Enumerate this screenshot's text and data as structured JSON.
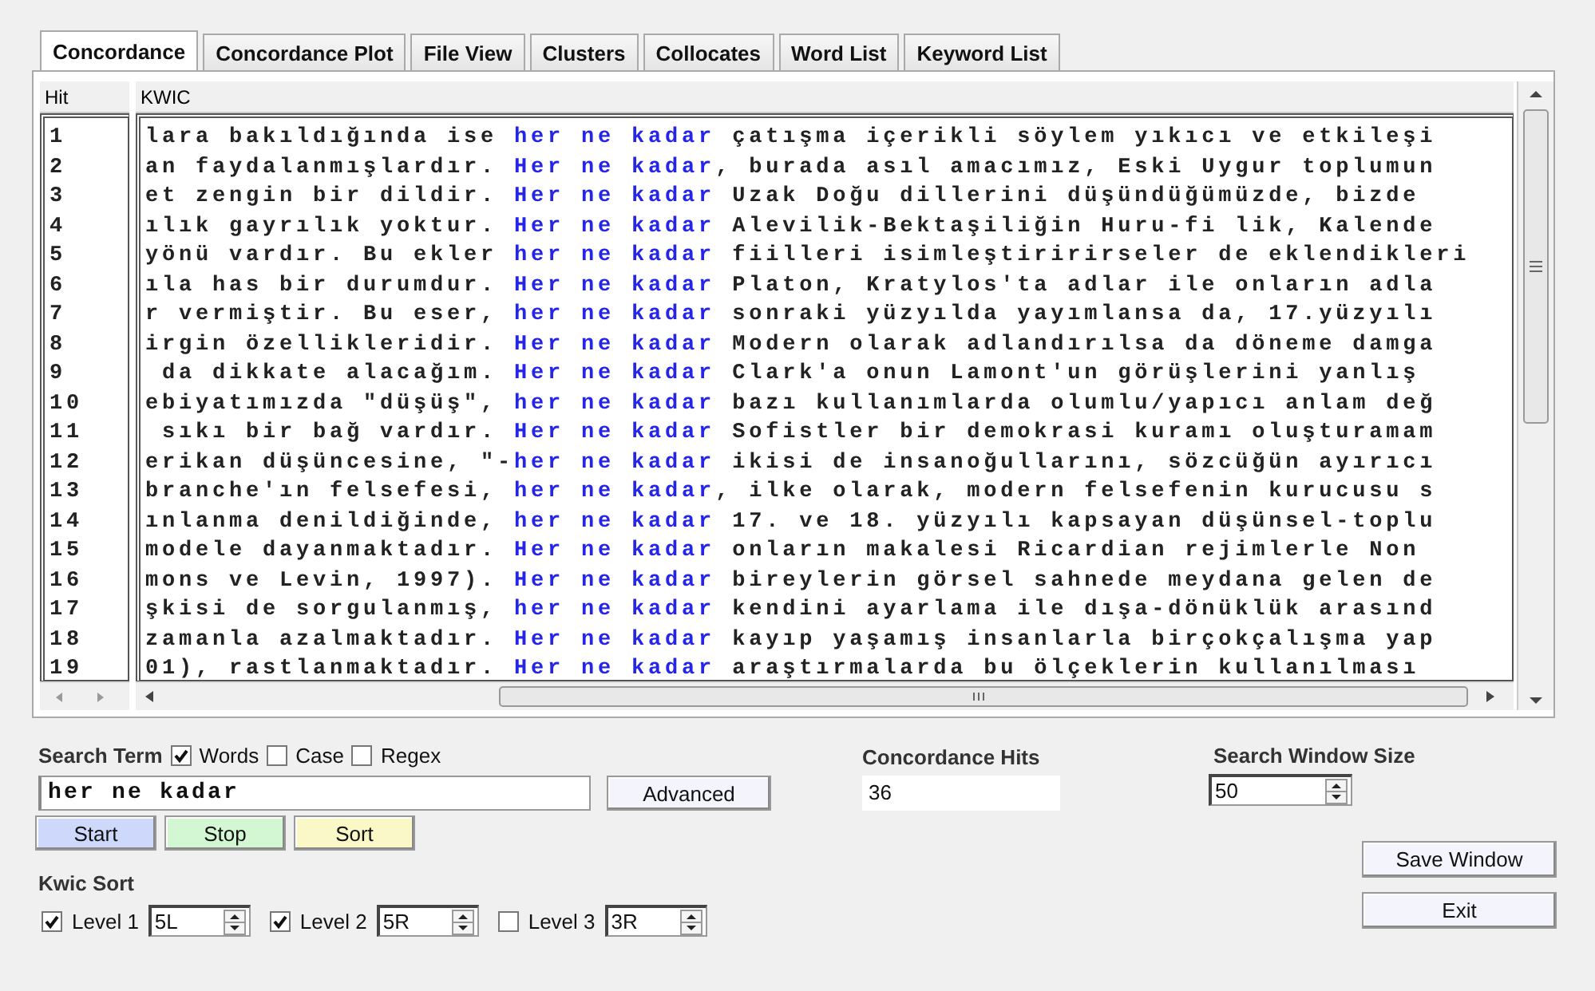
{
  "tabs": [
    {
      "label": "Concordance",
      "selected": true
    },
    {
      "label": "Concordance Plot",
      "selected": false
    },
    {
      "label": "File View",
      "selected": false
    },
    {
      "label": "Clusters",
      "selected": false
    },
    {
      "label": "Collocates",
      "selected": false
    },
    {
      "label": "Word List",
      "selected": false
    },
    {
      "label": "Keyword List",
      "selected": false
    }
  ],
  "table": {
    "columns": [
      "Hit",
      "KWIC"
    ],
    "rows": [
      {
        "hit": "1",
        "left": "lara bakıldığında ise ",
        "keyword": "her ne kadar",
        "right": " çatışma içerikli söylem yıkıcı ve etkileşi"
      },
      {
        "hit": "2",
        "left": "an faydalanmışlardır. ",
        "keyword": "Her ne kadar",
        "right": ", burada asıl amacımız, Eski Uygur toplumun"
      },
      {
        "hit": "3",
        "left": "et zengin bir dildir. ",
        "keyword": "Her ne kadar",
        "right": " Uzak Doğu dillerini düşündüğümüzde, bizde"
      },
      {
        "hit": "4",
        "left": "ılık gayrılık yoktur. ",
        "keyword": "Her ne kadar",
        "right": " Alevilik-Bektaşiliğin Huru-fi lik, Kalende"
      },
      {
        "hit": "5",
        "left": "yönü vardır. Bu ekler ",
        "keyword": "her ne kadar",
        "right": " fiilleri isimleştiririrseler de eklendikleri"
      },
      {
        "hit": "6",
        "left": "ıla has bir durumdur. ",
        "keyword": "Her ne kadar",
        "right": " Platon, Kratylos'ta adlar ile onların adla"
      },
      {
        "hit": "7",
        "left": "r vermiştir. Bu eser, ",
        "keyword": "her ne kadar",
        "right": " sonraki yüzyılda yayımlansa da, 17.yüzyılı"
      },
      {
        "hit": "8",
        "left": "irgin özellikleridir. ",
        "keyword": "Her ne kadar",
        "right": " Modern olarak adlandırılsa da döneme damga"
      },
      {
        "hit": "9",
        "left": " da dikkate alacağım. ",
        "keyword": "Her ne kadar",
        "right": " Clark'a onun Lamont'un görüşlerini yanlış"
      },
      {
        "hit": "10",
        "left": "ebiyatımızda \"düşüş\", ",
        "keyword": "her ne kadar",
        "right": " bazı kullanımlarda olumlu/yapıcı anlam değ"
      },
      {
        "hit": "11",
        "left": " sıkı bir bağ vardır. ",
        "keyword": "Her ne kadar",
        "right": " Sofistler bir demokrasi kuramı oluşturamam"
      },
      {
        "hit": "12",
        "left": "erikan düşüncesine, \"-",
        "keyword": "her ne kadar",
        "right": " ikisi de insanoğullarını, sözcüğün ayırıcı"
      },
      {
        "hit": "13",
        "left": "branche'ın felsefesi, ",
        "keyword": "her ne kadar",
        "right": ", ilke olarak, modern felsefenin kurucusu s"
      },
      {
        "hit": "14",
        "left": "ınlanma denildiğinde, ",
        "keyword": "her ne kadar",
        "right": " 17. ve 18. yüzyılı kapsayan düşünsel-toplu"
      },
      {
        "hit": "15",
        "left": "modele dayanmaktadır. ",
        "keyword": "Her ne kadar",
        "right": " onların makalesi Ricardian rejimlerle Non"
      },
      {
        "hit": "16",
        "left": "mons ve Levin, 1997). ",
        "keyword": "Her ne kadar",
        "right": " bireylerin görsel sahnede meydana gelen de"
      },
      {
        "hit": "17",
        "left": "şkisi de sorgulanmış, ",
        "keyword": "her ne kadar",
        "right": " kendini ayarlama ile dışa-dönüklük arasınd"
      },
      {
        "hit": "18",
        "left": "zamanla azalmaktadır. ",
        "keyword": "Her ne kadar",
        "right": " kayıp yaşamış insanlarla birçokçalışma yap"
      },
      {
        "hit": "19",
        "left": "01), rastlanmaktadır. ",
        "keyword": "Her ne kadar",
        "right": " araştırmalarda bu ölçeklerin kullanılması"
      }
    ]
  },
  "search": {
    "label": "Search Term",
    "options": [
      {
        "label": "Words",
        "checked": true
      },
      {
        "label": "Case",
        "checked": false
      },
      {
        "label": "Regex",
        "checked": false
      }
    ],
    "value": "her ne kadar"
  },
  "advanced_button": "Advanced",
  "action_buttons": [
    {
      "label": "Start",
      "color": "#cdd8fb"
    },
    {
      "label": "Stop",
      "color": "#d3f7d3"
    },
    {
      "label": "Sort",
      "color": "#fbf8c7"
    }
  ],
  "kwic_sort": {
    "label": "Kwic Sort",
    "levels": [
      {
        "label": "Level 1",
        "checked": true,
        "value": "5L"
      },
      {
        "label": "Level 2",
        "checked": true,
        "value": "5R"
      },
      {
        "label": "Level 3",
        "checked": false,
        "value": "3R"
      }
    ]
  },
  "concordance_hits": {
    "label": "Concordance Hits",
    "value": "36"
  },
  "search_window_size": {
    "label": "Search Window Size",
    "value": "50"
  },
  "buttons": [
    {
      "label": "Save Window"
    },
    {
      "label": "Exit"
    }
  ]
}
